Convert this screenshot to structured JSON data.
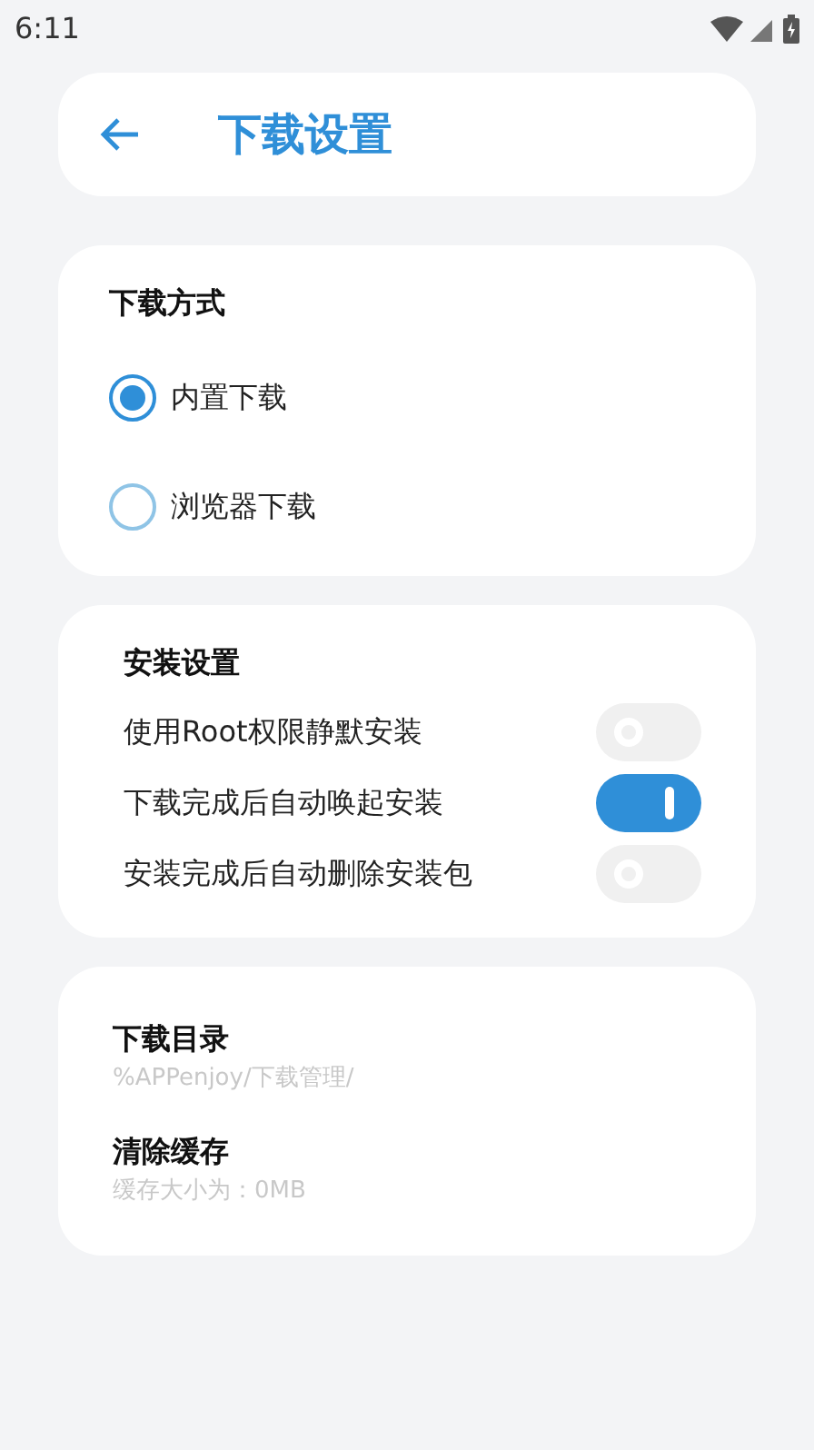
{
  "status_bar": {
    "time": "6:11"
  },
  "header": {
    "title": "下载设置"
  },
  "download_method": {
    "title": "下载方式",
    "options": [
      {
        "label": "内置下载",
        "selected": true
      },
      {
        "label": "浏览器下载",
        "selected": false
      }
    ]
  },
  "install_settings": {
    "title": "安装设置",
    "toggles": [
      {
        "label": "使用Root权限静默安装",
        "on": false
      },
      {
        "label": "下载完成后自动唤起安装",
        "on": true
      },
      {
        "label": "安装完成后自动删除安装包",
        "on": false
      }
    ]
  },
  "storage": {
    "items": [
      {
        "title": "下载目录",
        "subtitle": "%APPenjoy/下载管理/"
      },
      {
        "title": "清除缓存",
        "subtitle": "缓存大小为：0MB"
      }
    ]
  }
}
